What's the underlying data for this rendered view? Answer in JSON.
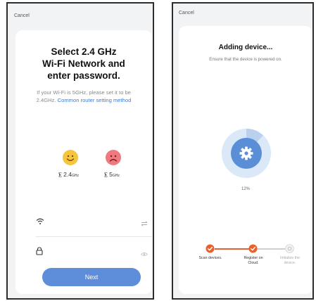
{
  "left_screen": {
    "cancel_label": "Cancel",
    "title_lines": [
      "Select 2.4 GHz",
      "Wi-Fi Network and",
      "enter password."
    ],
    "hint_text": "If your Wi-Fi is 5GHz, please set it to be 2.4GHz.",
    "hint_link": "Common router setting method",
    "bands": [
      {
        "value": "2.4",
        "unit": "GHz",
        "face": "happy-face-icon",
        "color": "#f6c53f"
      },
      {
        "value": "5",
        "unit": "GHz",
        "face": "sad-face-icon",
        "color": "#ee7a80"
      }
    ],
    "wifi_field": {
      "value": "",
      "lead_icon": "wifi-icon",
      "trail_icon": "switch-network-icon"
    },
    "password_field": {
      "value": "",
      "lead_icon": "lock-icon",
      "trail_icon": "eye-icon"
    },
    "next_label": "Next",
    "accent_color": "#5e8ed9"
  },
  "right_screen": {
    "cancel_label": "Cancel",
    "title": "Adding device...",
    "subtitle": "Ensure that the device is powered on.",
    "center_icon": "gear-icon",
    "progress_text": "12%",
    "progress_value": 0.12,
    "steps": [
      {
        "line1": "Scan devices.",
        "line2": "",
        "status": "done"
      },
      {
        "line1": "Register on",
        "line2": "Cloud.",
        "status": "done"
      },
      {
        "line1": "Initialize the",
        "line2": "device.",
        "status": "pending"
      }
    ],
    "accent_color": "#e8612c"
  }
}
